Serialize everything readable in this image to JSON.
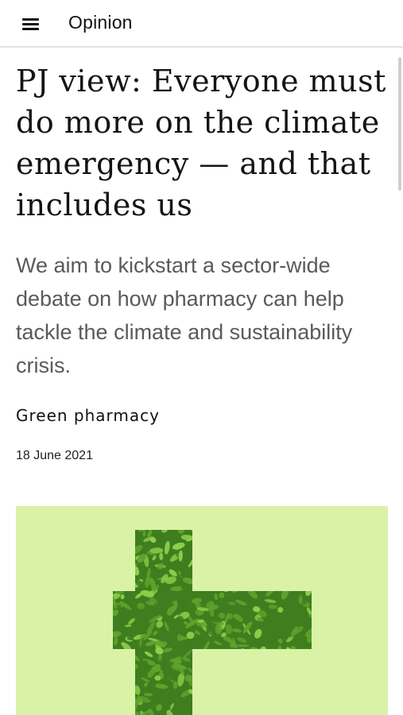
{
  "header": {
    "section": "Opinion",
    "menu_icon": "hamburger-menu-icon"
  },
  "article": {
    "headline": "PJ view: Everyone must do more on the climate emergency — and that includes us",
    "standfirst": "We aim to kickstart a sector-wide debate on how pharmacy can help tackle the climate and sustainability crisis.",
    "category": "Green pharmacy",
    "date": "18 June 2021"
  },
  "hero_image": {
    "subject": "leafy-green-cross-icon",
    "colors": {
      "background": "#d9f2a6",
      "leaf_dark": "#3f7d1f",
      "leaf_mid": "#5fa32c",
      "leaf_light": "#8fd04a"
    }
  }
}
